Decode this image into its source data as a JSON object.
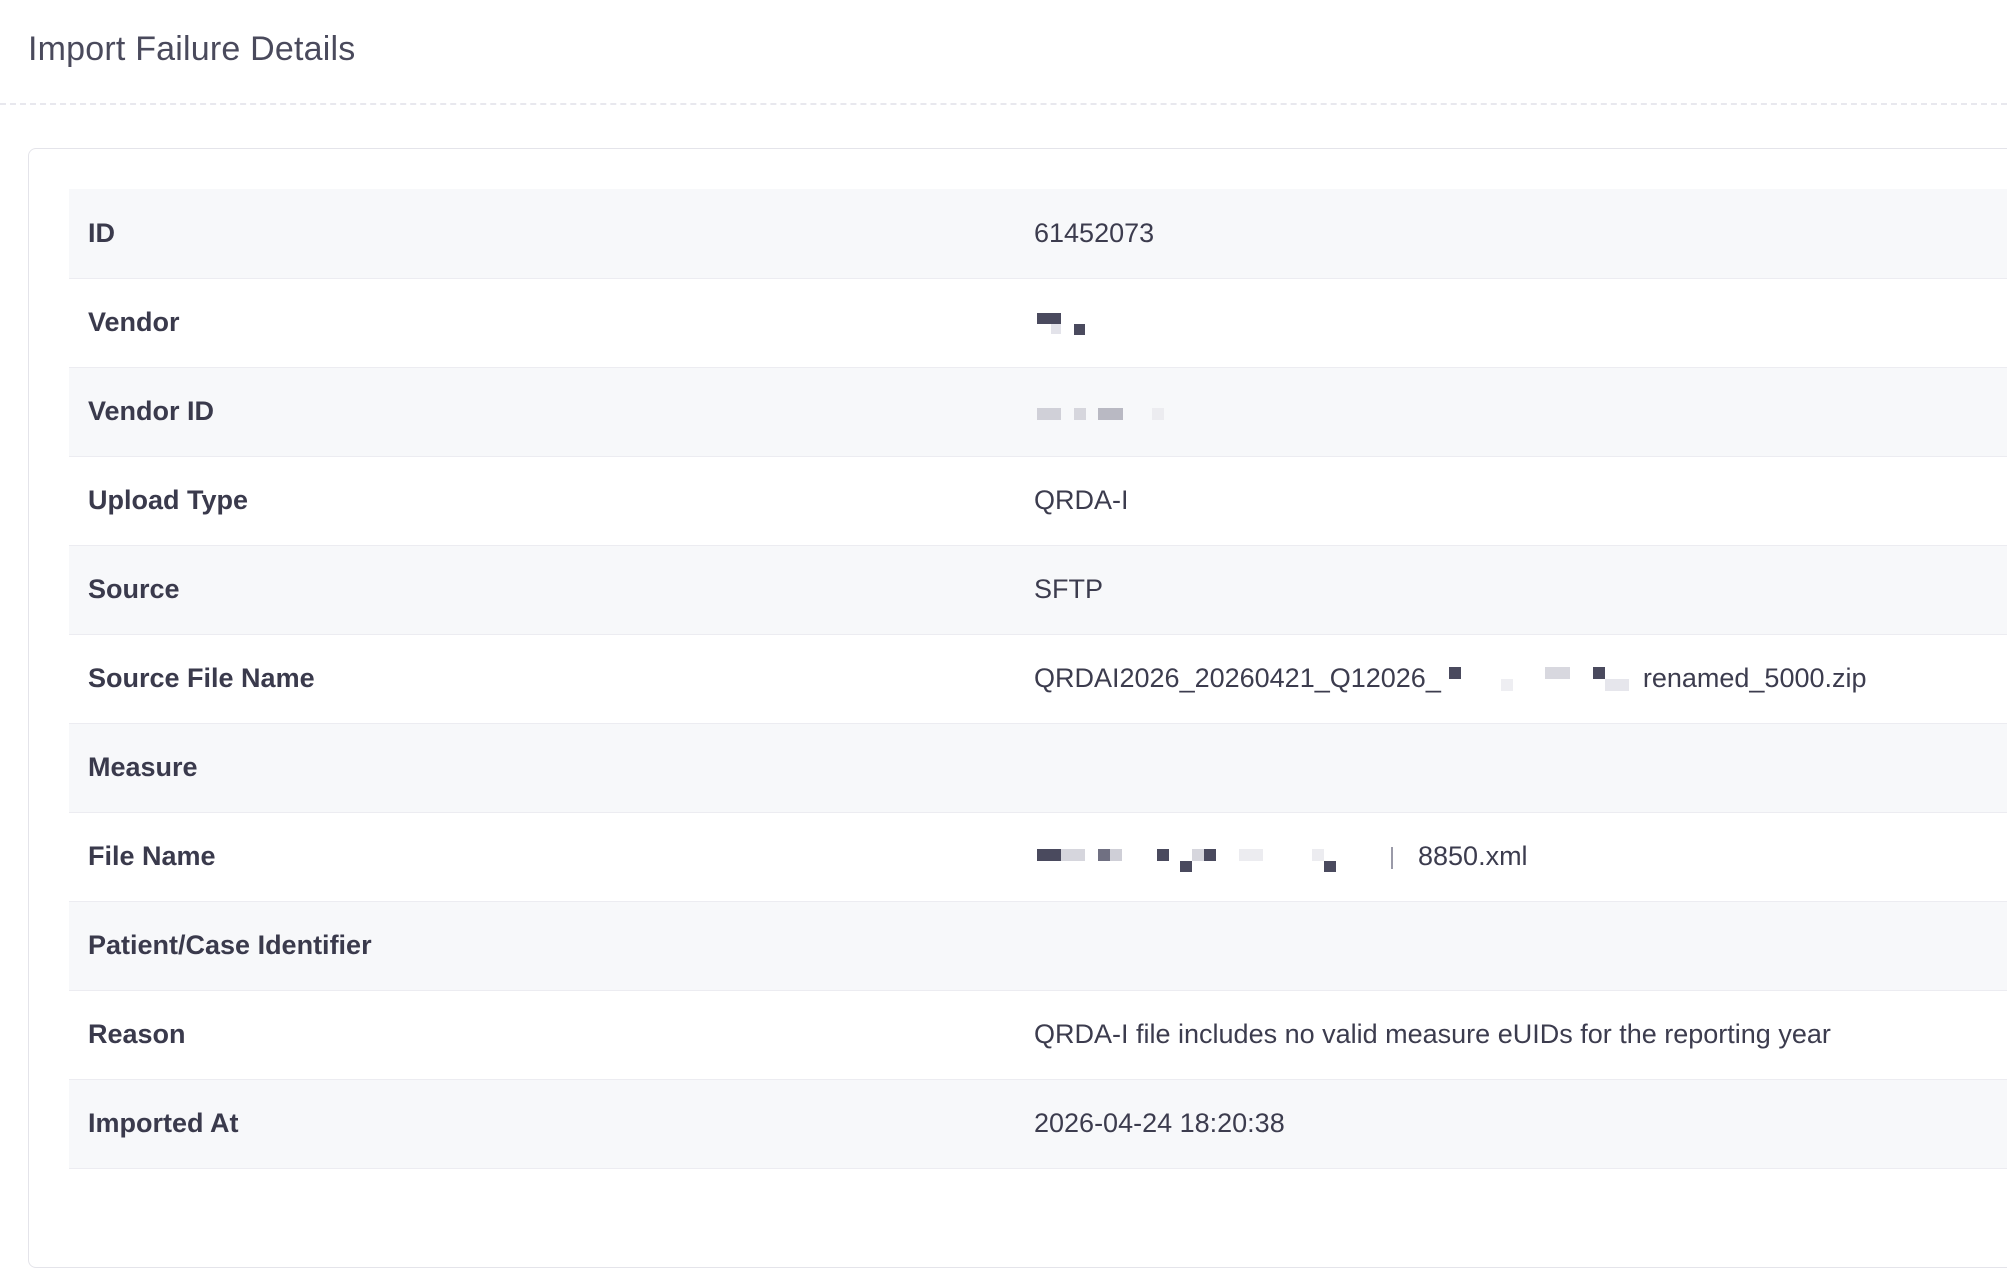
{
  "page": {
    "title": "Import Failure Details"
  },
  "details": {
    "id": {
      "label": "ID",
      "value": "61452073"
    },
    "vendor": {
      "label": "Vendor",
      "value": ""
    },
    "vendor_id": {
      "label": "Vendor ID",
      "value": ""
    },
    "upload_type": {
      "label": "Upload Type",
      "value": "QRDA-I"
    },
    "source": {
      "label": "Source",
      "value": "SFTP"
    },
    "source_file_name": {
      "label": "Source File Name",
      "value_prefix": "QRDAI2026_20260421_Q12026_",
      "value_suffix": "renamed_5000.zip"
    },
    "measure": {
      "label": "Measure",
      "value": ""
    },
    "file_name": {
      "label": "File Name",
      "value_suffix": "8850.xml"
    },
    "patient_case_identifier": {
      "label": "Patient/Case Identifier",
      "value": ""
    },
    "reason": {
      "label": "Reason",
      "value": "QRDA-I file includes no valid measure eUIDs for the reporting year"
    },
    "imported_at": {
      "label": "Imported At",
      "value": "2026-04-24 18:20:38"
    }
  },
  "colors": {
    "row_alt": "#f7f8fa",
    "border": "#ececf1",
    "text": "#3c3c4e",
    "redaction_dark": "#4a4a5e"
  }
}
